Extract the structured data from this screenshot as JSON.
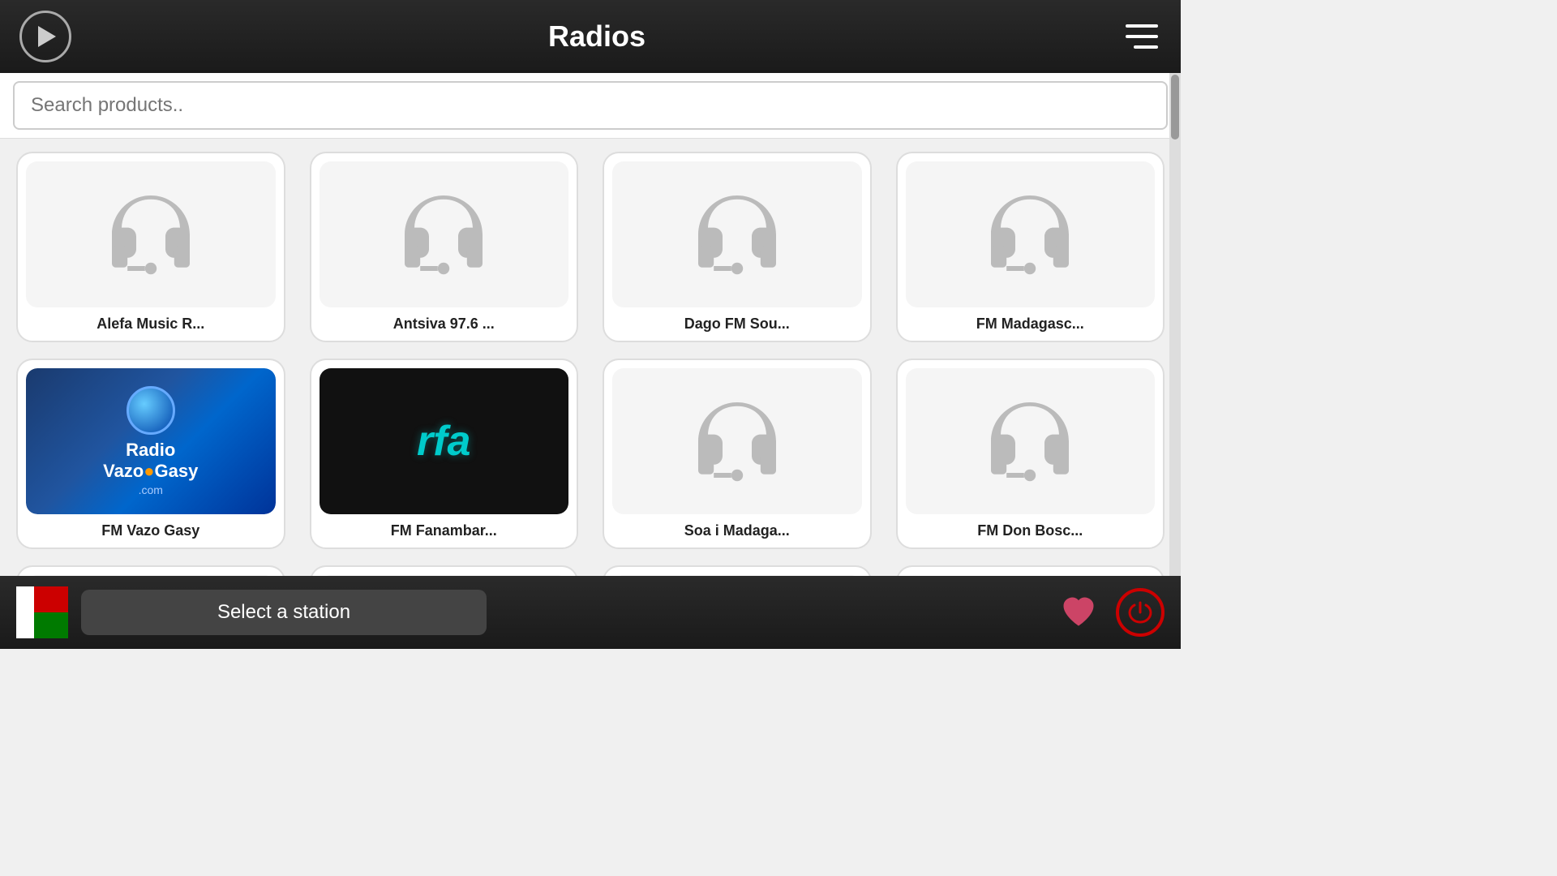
{
  "header": {
    "title": "Radios",
    "play_label": "play",
    "menu_label": "menu"
  },
  "search": {
    "placeholder": "Search products.."
  },
  "stations": [
    {
      "id": 1,
      "name": "Alefa Music R...",
      "type": "headphone"
    },
    {
      "id": 2,
      "name": "Antsiva 97.6 ...",
      "type": "headphone"
    },
    {
      "id": 3,
      "name": "Dago FM Sou...",
      "type": "headphone"
    },
    {
      "id": 4,
      "name": "FM Madagasc...",
      "type": "headphone"
    },
    {
      "id": 5,
      "name": "FM Vazo Gasy",
      "type": "vazo"
    },
    {
      "id": 6,
      "name": "FM Fanambar...",
      "type": "rfa"
    },
    {
      "id": 7,
      "name": "Soa i Madaga...",
      "type": "headphone"
    },
    {
      "id": 8,
      "name": "FM Don Bosc...",
      "type": "headphone"
    },
    {
      "id": 9,
      "name": "",
      "type": "headphone_partial"
    },
    {
      "id": 10,
      "name": "",
      "type": "headphone_partial"
    },
    {
      "id": 11,
      "name": "",
      "type": "headphone_partial"
    },
    {
      "id": 12,
      "name": "",
      "type": "red_partial"
    }
  ],
  "bottom_bar": {
    "select_label": "Select a station",
    "flag_alt": "Madagascar flag"
  }
}
